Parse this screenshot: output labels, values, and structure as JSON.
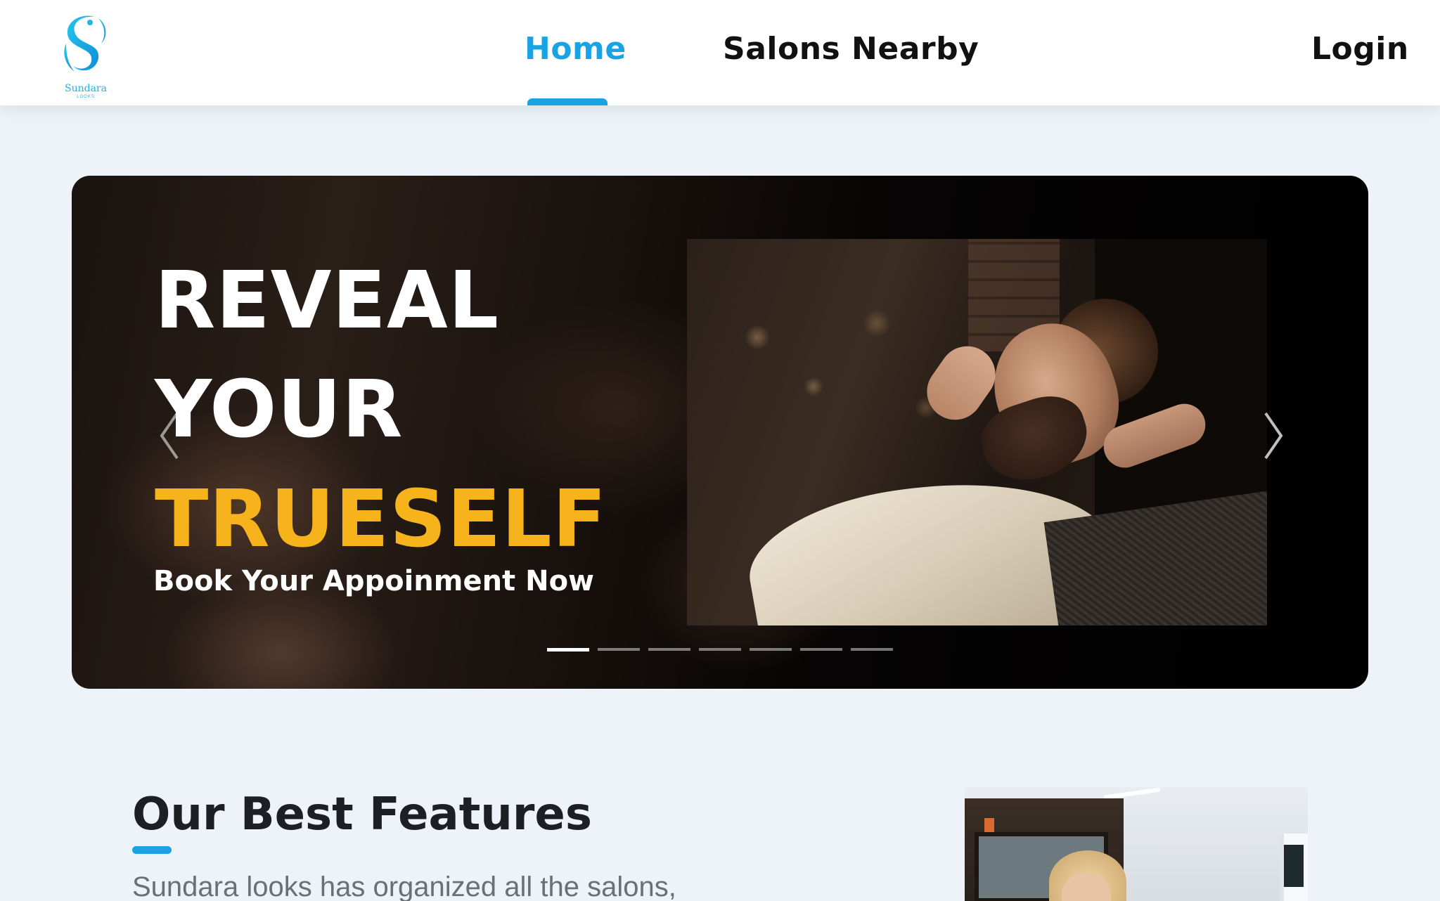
{
  "header": {
    "logo": {
      "name": "Sundara",
      "tagline": "LOOKS"
    },
    "nav": {
      "home": "Home",
      "salons_nearby": "Salons Nearby",
      "login": "Login"
    },
    "active_item": "Home",
    "accent_color": "#1aa3e4"
  },
  "carousel": {
    "slide": {
      "line1": "REVEAL",
      "line2": "YOUR",
      "line3": "TRUESELF",
      "subtitle": "Book Your Appoinment Now",
      "highlight_color": "#f6b31b"
    },
    "slide_count": 7,
    "active_index": 0,
    "prev_icon": "chevron-left-icon",
    "next_icon": "chevron-right-icon"
  },
  "features": {
    "title": "Our Best Features",
    "description": "Sundara looks has organized all the salons,"
  }
}
